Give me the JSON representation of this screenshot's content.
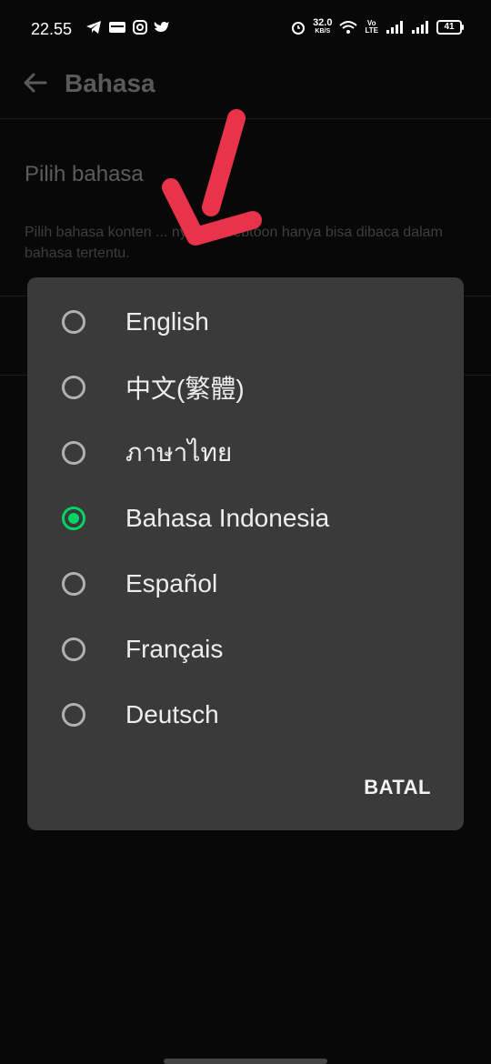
{
  "status_bar": {
    "time": "22.55",
    "net_speed": "32.0",
    "net_speed_unit": "KB/S",
    "volte": "Vo\nLTE",
    "battery": "41"
  },
  "app_bar": {
    "title": "Bahasa"
  },
  "section": {
    "title": "Pilih bahasa",
    "description": "Pilih bahasa konten ... nyakan webtoon hanya bisa dibaca dalam bahasa tertentu."
  },
  "dialog": {
    "options": [
      {
        "label": "English",
        "checked": false
      },
      {
        "label": "中文(繁體)",
        "checked": false
      },
      {
        "label": "ภาษาไทย",
        "checked": false
      },
      {
        "label": "Bahasa Indonesia",
        "checked": true
      },
      {
        "label": "Español",
        "checked": false
      },
      {
        "label": "Français",
        "checked": false
      },
      {
        "label": "Deutsch",
        "checked": false
      }
    ],
    "cancel_label": "BATAL"
  },
  "colors": {
    "accent": "#00d564",
    "annotation": "#e8334a",
    "dialog_bg": "#3a3a3a"
  }
}
